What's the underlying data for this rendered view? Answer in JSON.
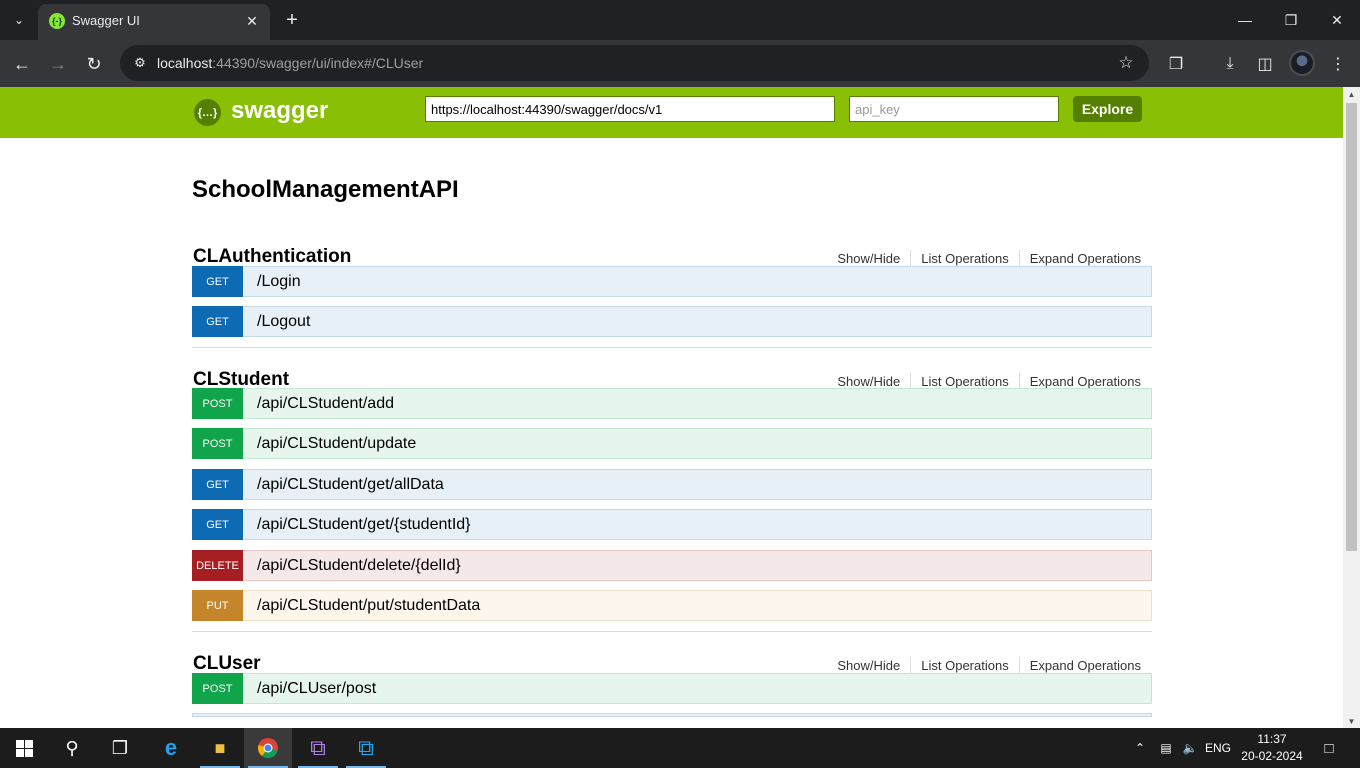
{
  "browser": {
    "tab_title": "Swagger UI",
    "tab_favicon": "{-}",
    "url_host": "localhost",
    "url_rest": ":44390/swagger/ui/index#/CLUser",
    "icons": [
      "tab-list-icon",
      "close-icon",
      "new-tab-icon",
      "minimize-icon",
      "restore-icon",
      "window-close-icon",
      "back-icon",
      "forward-icon",
      "reload-icon",
      "site-info-icon",
      "bookmark-star-icon",
      "extensions-icon",
      "download-icon",
      "side-panel-icon",
      "profile-avatar",
      "menu-icon"
    ]
  },
  "swagger": {
    "logo_mark": "{…}",
    "logo_text": "swagger",
    "spec_url": "https://localhost:44390/swagger/docs/v1",
    "api_key_placeholder": "api_key",
    "explore_label": "Explore"
  },
  "api_title": "SchoolManagementAPI",
  "resource_options": [
    "Show/Hide",
    "List Operations",
    "Expand Operations"
  ],
  "resources": [
    {
      "name": "CLAuthentication",
      "operations": [
        {
          "method": "GET",
          "path": "/Login"
        },
        {
          "method": "GET",
          "path": "/Logout"
        }
      ]
    },
    {
      "name": "CLStudent",
      "operations": [
        {
          "method": "POST",
          "path": "/api/CLStudent/add"
        },
        {
          "method": "POST",
          "path": "/api/CLStudent/update"
        },
        {
          "method": "GET",
          "path": "/api/CLStudent/get/allData"
        },
        {
          "method": "GET",
          "path": "/api/CLStudent/get/{studentId}"
        },
        {
          "method": "DELETE",
          "path": "/api/CLStudent/delete/{delId}"
        },
        {
          "method": "PUT",
          "path": "/api/CLStudent/put/studentData"
        }
      ]
    },
    {
      "name": "CLUser",
      "operations": [
        {
          "method": "POST",
          "path": "/api/CLUser/post"
        }
      ]
    }
  ],
  "colors": {
    "swagger_green": "#89bf04",
    "get": "#0f6ab4",
    "post": "#10a54a",
    "delete": "#a41e22",
    "put": "#c5862b"
  },
  "taskbar": {
    "apps": [
      "start-icon",
      "search-icon",
      "task-view-icon",
      "internet-explorer-icon",
      "file-explorer-icon",
      "chrome-icon",
      "visual-studio-icon",
      "vscode-icon"
    ],
    "language": "ENG",
    "time": "11:37",
    "date": "20-02-2024"
  }
}
